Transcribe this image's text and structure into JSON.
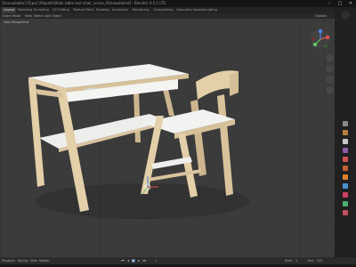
{
  "window": {
    "title": "[Unavailable] [Type] [filepath]/Kids table and chair_scene_ASnewsblend] - Blender 4.5.2 LTS",
    "controls": [
      "–",
      "□",
      "✕"
    ]
  },
  "workspace_tabs": [
    {
      "label": "Layout",
      "active": true
    },
    {
      "label": "Modeling",
      "active": false
    },
    {
      "label": "Sculpting",
      "active": false
    },
    {
      "label": "UV Editing",
      "active": false
    },
    {
      "label": "Texture Paint",
      "active": false
    },
    {
      "label": "Shading",
      "active": false
    },
    {
      "label": "Animation",
      "active": false
    },
    {
      "label": "Rendering",
      "active": false
    },
    {
      "label": "Compositing",
      "active": false
    },
    {
      "label": "Geometry Nodes",
      "active": false
    },
    {
      "label": "Scripting",
      "active": false
    }
  ],
  "viewport_header": {
    "mode": "Object Mode",
    "menus": [
      "View",
      "Select",
      "Add",
      "Object"
    ],
    "right": "Options"
  },
  "viewport": {
    "overlay_label": "User Perspective"
  },
  "timeline": {
    "playback": "Playback",
    "keying": "Keying",
    "view": "View",
    "marker": "Marker",
    "frame_current": "1",
    "start_label": "Start",
    "start": "1",
    "end_label": "End",
    "end": "250"
  },
  "colors": {
    "accent": "#4a6fa0",
    "wood": "#e3cfa8",
    "white_top": "#f0f0ee"
  },
  "icons": [
    "gizmo-x-icon",
    "gizmo-y-icon",
    "gizmo-z-icon",
    "zoom-icon",
    "pan-icon",
    "camera-icon",
    "grid-icon",
    "play-icon"
  ]
}
